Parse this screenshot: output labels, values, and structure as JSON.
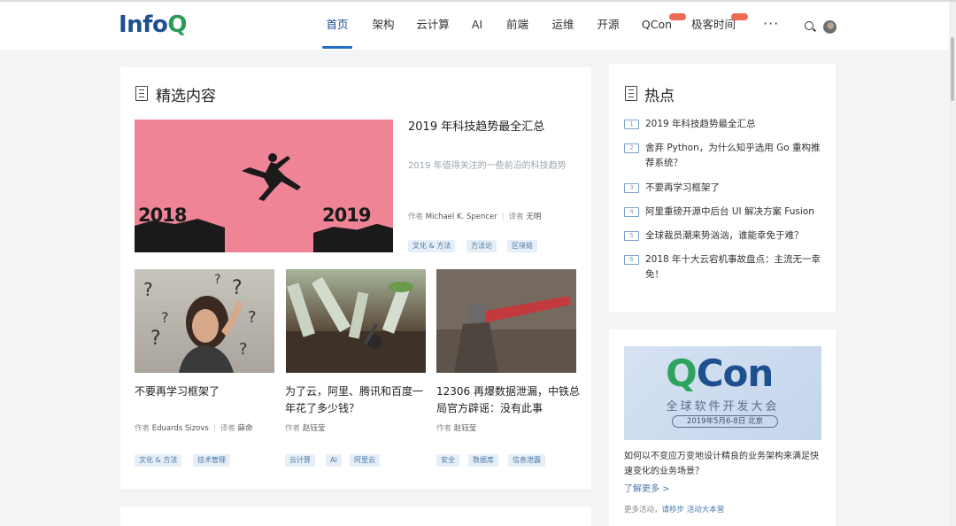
{
  "header": {
    "logo": "InfoQ",
    "nav": [
      {
        "label": "首页",
        "active": true
      },
      {
        "label": "架构"
      },
      {
        "label": "云计算"
      },
      {
        "label": "AI"
      },
      {
        "label": "前端"
      },
      {
        "label": "运维"
      },
      {
        "label": "开源"
      },
      {
        "label": "QCon",
        "badge": true
      },
      {
        "label": "极客时间",
        "badge": true
      }
    ],
    "more": "···"
  },
  "featured": {
    "title": "精选内容",
    "main_article": {
      "image_text_left": "2018",
      "image_text_right": "2019",
      "title": "2019 年科技趋势最全汇总",
      "subtitle": "2019 年值得关注的一些前沿的科技趋势",
      "author_label": "作者",
      "author": "Michael K. Spencer",
      "translator_label": "译者",
      "translator": "无明",
      "tags": [
        "文化 & 方法",
        "方法论",
        "区块链"
      ]
    },
    "articles": [
      {
        "title": "不要再学习框架了",
        "author_label": "作者",
        "author": "Eduards Sizovs",
        "translator_label": "译者",
        "translator": "薛命",
        "tags": [
          "文化 & 方法",
          "技术管理"
        ]
      },
      {
        "title": "为了云，阿里、腾讯和百度一年花了多少钱？",
        "author_label": "作者",
        "author": "赵钰莹",
        "tags": [
          "云计算",
          "AI",
          "阿里云"
        ]
      },
      {
        "title": "12306 再爆数据泄漏，中铁总局官方辟谣：没有此事",
        "author_label": "作者",
        "author": "赵钰莹",
        "tags": [
          "安全",
          "数据库",
          "信息泄露"
        ]
      }
    ]
  },
  "hot": {
    "title": "热点",
    "items": [
      {
        "num": "1",
        "text": "2019 年科技趋势最全汇总"
      },
      {
        "num": "2",
        "text": "舍弃 Python，为什么知乎选用 Go 重构推荐系统？"
      },
      {
        "num": "3",
        "text": "不要再学习框架了"
      },
      {
        "num": "4",
        "text": "阿里重磅开源中后台 UI 解决方案 Fusion"
      },
      {
        "num": "5",
        "text": "全球裁员潮来势汹汹，谁能幸免于难？"
      },
      {
        "num": "6",
        "text": "2018 年十大云宕机事故盘点：主流无一幸免！"
      }
    ]
  },
  "qcon": {
    "banner_q": "Q",
    "banner_con": "Con",
    "banner_sub": "全球软件开发大会",
    "banner_date": "2019年5月6-8日 北京",
    "desc": "如何以不变应万变地设计精良的业务架构来满足快速变化的业务场景？",
    "link": "了解更多 >",
    "meta_label": "更多活动，",
    "meta_link": "请移步 活动大本营"
  },
  "colors": {
    "brand_blue": "#1e4f8f",
    "brand_green": "#2d9a5a",
    "nav_active": "#1f6fc9",
    "badge": "#ef6a55",
    "tag_text": "#4e79a7",
    "tag_bg": "#e6eef7"
  }
}
